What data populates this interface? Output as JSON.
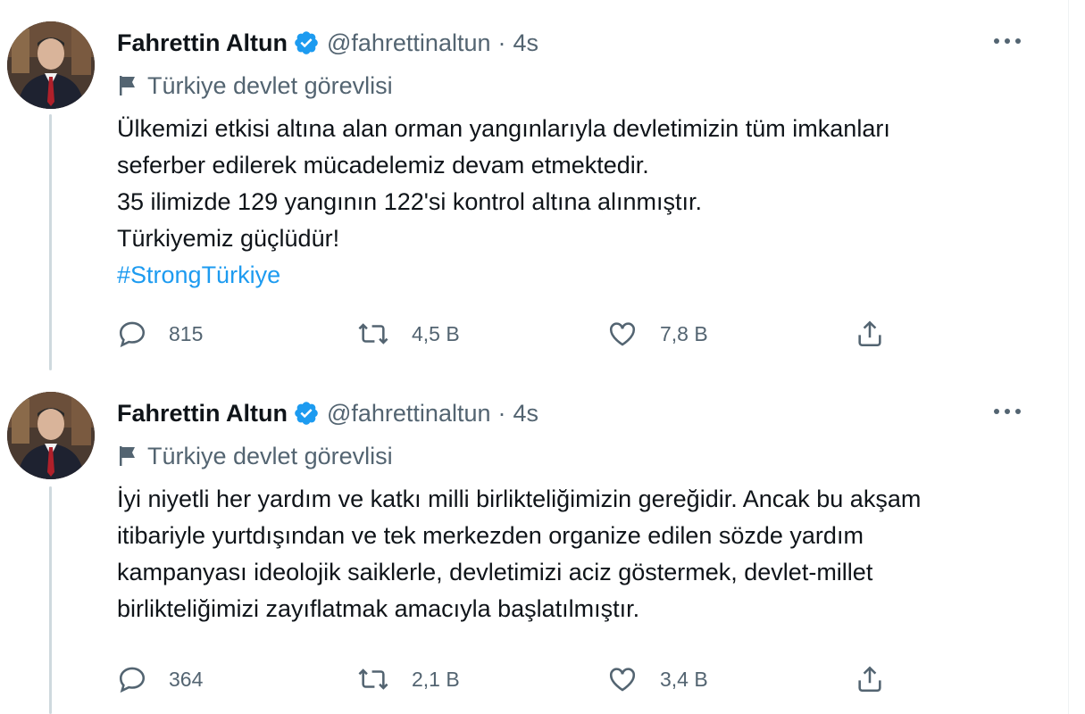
{
  "tweets": [
    {
      "author": {
        "name": "Fahrettin Altun",
        "handle": "@fahrettinaltun",
        "time": "4s"
      },
      "label": "Türkiye devlet görevlisi",
      "lines": [
        "Ülkemizi etkisi altına alan orman yangınlarıyla devletimizin tüm imkanları",
        "seferber edilerek mücadelemiz devam etmektedir.",
        "35 ilimizde 129 yangının 122'si kontrol altına alınmıştır.",
        "Türkiyemiz güçlüdür!"
      ],
      "hashtag": "#StrongTürkiye",
      "stats": {
        "replies": "815",
        "retweets": "4,5 B",
        "likes": "7,8 B"
      }
    },
    {
      "author": {
        "name": "Fahrettin Altun",
        "handle": "@fahrettinaltun",
        "time": "4s"
      },
      "label": "Türkiye devlet görevlisi",
      "lines": [
        "İyi niyetli her yardım ve katkı milli birlikteliğimizin gereğidir. Ancak bu akşam",
        "itibariyle yurtdışından ve tek merkezden organize edilen sözde yardım",
        "kampanyası ideolojik saiklerle, devletimizi aciz göstermek, devlet-millet",
        "birlikteliğimizi zayıflatmak amacıyla başlatılmıştır."
      ],
      "stats": {
        "replies": "364",
        "retweets": "2,1 B",
        "likes": "3,4 B"
      }
    }
  ],
  "colors": {
    "accent": "#1d9bf0",
    "secondary_text": "#536471",
    "primary_text": "#0f1419"
  },
  "icons": [
    "verified-badge-icon",
    "more-icon",
    "flag-icon",
    "reply-icon",
    "retweet-icon",
    "like-icon",
    "share-icon"
  ]
}
